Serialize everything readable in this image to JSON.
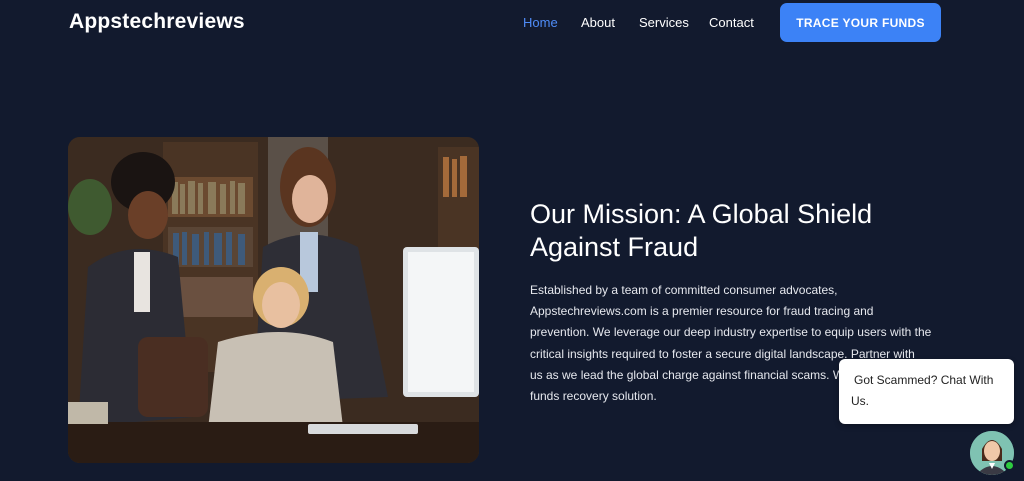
{
  "header": {
    "brand": "Appstechreviews",
    "nav": [
      {
        "label": "Home",
        "active": true
      },
      {
        "label": "About",
        "active": false
      },
      {
        "label": "Services",
        "active": false
      },
      {
        "label": "Contact",
        "active": false
      }
    ],
    "cta_label": "TRACE YOUR FUNDS"
  },
  "hero": {
    "image_alt": "Three women reviewing data at an office desk",
    "title_line1": "Our Mission: A Global Shield",
    "title_line2": "Against Fraud",
    "text_lines": [
      "Established by a team of committed consumer advocates,",
      "Appstechreviews.com is a premier resource for fraud tracing and",
      "prevention. We leverage our deep industry expertise to equip users with the",
      "critical insights required to foster a secure digital landscape. Partner with",
      "us as we lead the global charge against financial scams. W",
      "funds recovery solution."
    ]
  },
  "chat": {
    "line1": "Got Scammed? Chat With",
    "line2": "Us."
  },
  "colors": {
    "background": "#121a2e",
    "accent": "#3c82f6",
    "active_nav": "#4f8cf7"
  }
}
